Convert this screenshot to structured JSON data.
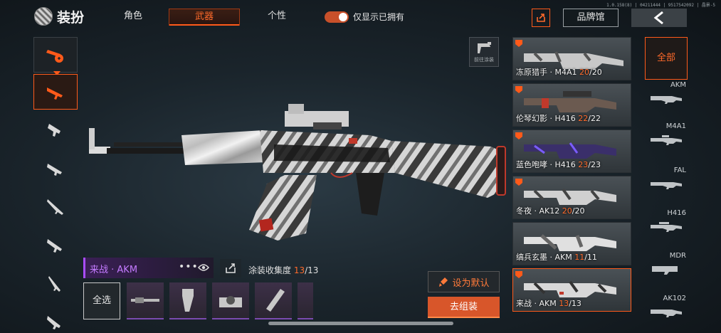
{
  "version": "1.0.158(8) | 04211444 | 9517542092 | 晶景-5",
  "header": {
    "title": "装扮",
    "tabs": [
      {
        "label": "角色",
        "active": false
      },
      {
        "label": "武器",
        "active": true
      },
      {
        "label": "个性",
        "active": false
      }
    ],
    "toggle_label": "仅显示已拥有",
    "brand_button": "品牌馆"
  },
  "coating_button": "前往涂装",
  "info": {
    "skin_name": "来战 · AKM",
    "dots": "•••",
    "collect_label": "涂装收集度",
    "collect_current": "13",
    "collect_total": "/13"
  },
  "bottom": {
    "select_all": "全选"
  },
  "actions": {
    "set_default": "设为默认",
    "assemble": "去组装"
  },
  "skins": [
    {
      "name": "冻原猎手 · M4A1",
      "current": "20",
      "total": "/20",
      "selected": false
    },
    {
      "name": "伦琴幻影 · H416",
      "current": "22",
      "total": "/22",
      "selected": false
    },
    {
      "name": "蓝色咆哮 · H416",
      "current": "23",
      "total": "/23",
      "selected": false
    },
    {
      "name": "冬夜 · AK12",
      "current": "20",
      "total": "/20",
      "selected": false
    },
    {
      "name": "缟兵玄墨 · AKM",
      "current": "11",
      "total": "/11",
      "selected": false
    },
    {
      "name": "来战 · AKM",
      "current": "13",
      "total": "/13",
      "selected": true
    }
  ],
  "categories": {
    "all": "全部",
    "items": [
      "AKM",
      "M4A1",
      "FAL",
      "H416",
      "MDR",
      "AK102"
    ]
  },
  "colors": {
    "accent": "#ff5a1a",
    "purple_rarity": "#a94cff"
  }
}
